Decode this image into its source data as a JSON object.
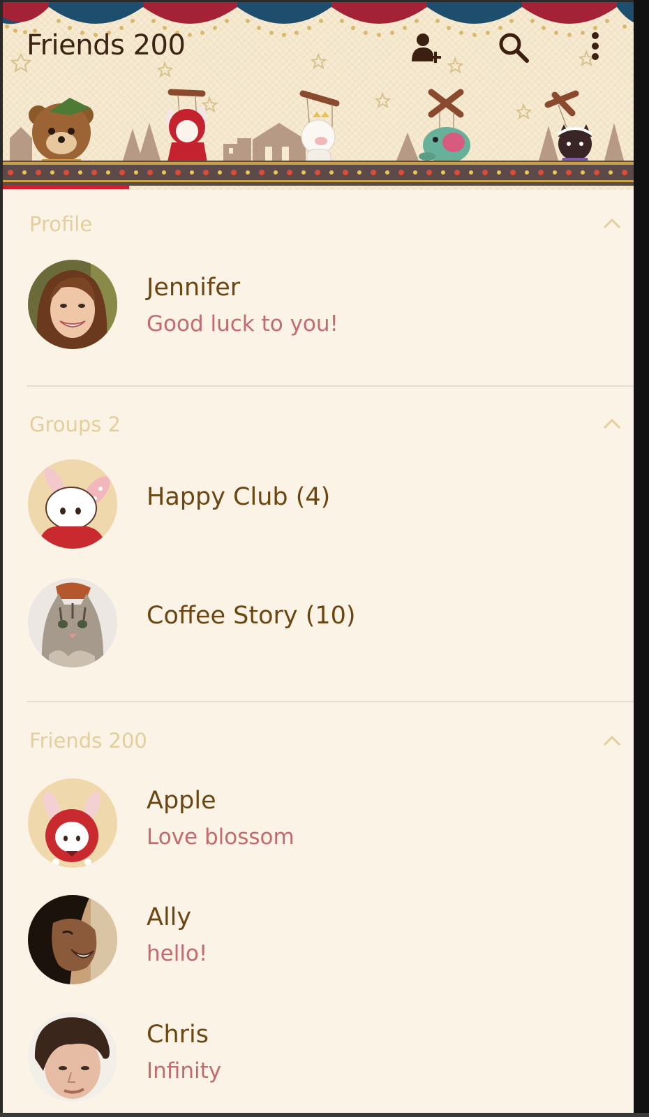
{
  "header": {
    "title": "Friends 200",
    "icons": [
      "add-friend-icon",
      "search-icon",
      "more-options-icon"
    ]
  },
  "sections": {
    "profile": {
      "label": "Profile"
    },
    "groups": {
      "label": "Groups 2"
    },
    "friends": {
      "label": "Friends 200"
    }
  },
  "profile": {
    "name": "Jennifer",
    "status": "Good luck to you!"
  },
  "groups": [
    {
      "name": "Happy Club (4)"
    },
    {
      "name": "Coffee Story (10)"
    }
  ],
  "friends": [
    {
      "name": "Apple",
      "status": "Love blossom"
    },
    {
      "name": "Ally",
      "status": "hello!"
    },
    {
      "name": "Chris",
      "status": "Infinity"
    }
  ],
  "colors": {
    "title": "#3b2414",
    "section_label": "#e3cf9c",
    "name": "#6b4612",
    "status": "#c36a6f",
    "background": "#fbf3e6",
    "tab_indicator": "#cf1f2a"
  }
}
